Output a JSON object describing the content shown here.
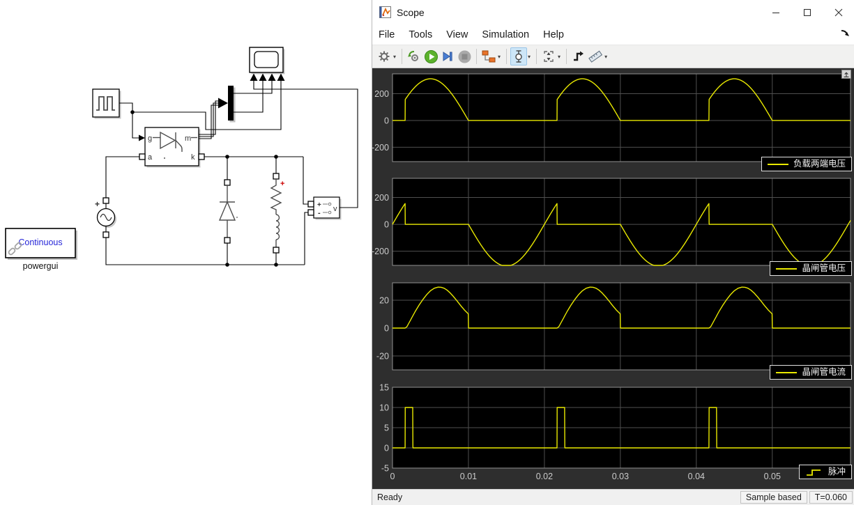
{
  "colors": {
    "waveform": "#e9e900",
    "plot_bg": "#000000",
    "figure_bg": "#2e2e2e",
    "grid": "#4f4f4f",
    "axes_border": "#919191",
    "tick_label": "#cbcbcb",
    "selected_button_bg": "#cde6f7"
  },
  "window": {
    "title": "Scope"
  },
  "menu": {
    "items": [
      "File",
      "Tools",
      "View",
      "Simulation",
      "Help"
    ]
  },
  "toolbar": {
    "buttons": [
      {
        "name": "settings",
        "icon": "gear-icon",
        "has_dropdown": true
      },
      {
        "name": "step-back",
        "icon": "gear-arrow-icon"
      },
      {
        "name": "run",
        "icon": "play-icon"
      },
      {
        "name": "step-forward",
        "icon": "step-forward-icon"
      },
      {
        "name": "stop",
        "icon": "stop-icon",
        "disabled": true
      },
      {
        "name": "highlight-simulink-block",
        "icon": "blocks-icon",
        "has_dropdown": true
      },
      {
        "name": "zoom",
        "icon": "zoom-cursor-icon",
        "selected": true,
        "has_dropdown": true
      },
      {
        "name": "scale-axes",
        "icon": "scale-axes-icon",
        "has_dropdown": true
      },
      {
        "name": "trigger",
        "icon": "trigger-icon"
      },
      {
        "name": "measurements",
        "icon": "ruler-icon",
        "has_dropdown": true
      }
    ]
  },
  "status": {
    "state": "Ready",
    "sample_mode": "Sample based",
    "sim_time": "T=0.060"
  },
  "model": {
    "powergui": {
      "mode_text": "Continuous",
      "block_label": "powergui"
    },
    "thyristor": {
      "port_g": "g",
      "port_a": "a",
      "port_m": "m",
      "port_k": "k"
    },
    "voltage_measurement": {
      "plus": "+",
      "minus": "-",
      "output": "v"
    },
    "ac_source": {
      "plus": "+"
    },
    "rlc_branch": {
      "plus": "+"
    }
  },
  "chart_data": [
    {
      "type": "line",
      "legend": "负载两端电压",
      "xlim": [
        0,
        0.0603
      ],
      "ylim": [
        -307,
        348
      ],
      "xticks": [
        0,
        0.01,
        0.02,
        0.03,
        0.04,
        0.05
      ],
      "yticks": [
        200,
        0,
        -200
      ],
      "show_xtick_labels": false,
      "signal": {
        "kind": "gated_sine",
        "amplitude": 311,
        "period": 0.02,
        "gate": [
          0.00167,
          0.01
        ]
      }
    },
    {
      "type": "line",
      "legend": "晶闸管电压",
      "xlim": [
        0,
        0.0603
      ],
      "ylim": [
        -306,
        343
      ],
      "xticks": [
        0,
        0.01,
        0.02,
        0.03,
        0.04,
        0.05
      ],
      "yticks": [
        200,
        0,
        -200
      ],
      "show_xtick_labels": false,
      "signal": {
        "kind": "blocked_sine",
        "amplitude": 311,
        "period": 0.02,
        "zero": [
          0.00167,
          0.01
        ]
      }
    },
    {
      "type": "line",
      "legend": "晶闸管电流",
      "xlim": [
        0,
        0.0603
      ],
      "ylim": [
        -30,
        32.5
      ],
      "xticks": [
        0,
        0.01,
        0.02,
        0.03,
        0.04,
        0.05
      ],
      "yticks": [
        20,
        0,
        -20
      ],
      "show_xtick_labels": false,
      "signal": {
        "kind": "periodic_points",
        "period": 0.02,
        "points": [
          [
            0,
            0
          ],
          [
            0.00167,
            0
          ],
          [
            0.0019,
            1
          ],
          [
            0.0022,
            4
          ],
          [
            0.0026,
            8
          ],
          [
            0.003,
            12
          ],
          [
            0.0035,
            16.5
          ],
          [
            0.004,
            20.5
          ],
          [
            0.0045,
            24
          ],
          [
            0.005,
            26.8
          ],
          [
            0.0055,
            28.6
          ],
          [
            0.006,
            29.4
          ],
          [
            0.0064,
            29.3
          ],
          [
            0.0068,
            28.6
          ],
          [
            0.0072,
            27.2
          ],
          [
            0.0076,
            25.2
          ],
          [
            0.008,
            22.8
          ],
          [
            0.0085,
            19.5
          ],
          [
            0.009,
            16
          ],
          [
            0.0095,
            12.8
          ],
          [
            0.00998,
            10.2
          ],
          [
            0.01,
            0
          ],
          [
            0.02,
            0
          ]
        ]
      }
    },
    {
      "type": "line",
      "legend": "脉冲",
      "xlim": [
        0,
        0.0603
      ],
      "ylim": [
        -5,
        15
      ],
      "xticks": [
        0,
        0.01,
        0.02,
        0.03,
        0.04,
        0.05
      ],
      "xtick_labels": [
        "0",
        "0.01",
        "0.02",
        "0.03",
        "0.04",
        "0.05"
      ],
      "yticks": [
        15,
        10,
        5,
        0,
        -5
      ],
      "show_xtick_labels": true,
      "signal": {
        "kind": "pulse",
        "period": 0.02,
        "start": 0.00167,
        "width": 0.001,
        "high": 10,
        "low": 0
      }
    }
  ]
}
